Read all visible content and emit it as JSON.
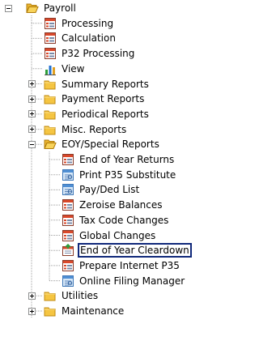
{
  "tree": {
    "root": {
      "label": "Payroll",
      "icon": "folder-open-icon",
      "expanded": true
    },
    "payroll_children": [
      {
        "label": "Processing",
        "icon": "report-icon"
      },
      {
        "label": "Calculation",
        "icon": "report-icon"
      },
      {
        "label": "P32 Processing",
        "icon": "report-icon"
      },
      {
        "label": "View",
        "icon": "bar-chart-icon"
      },
      {
        "label": "Summary Reports",
        "icon": "folder-icon",
        "expanded": false
      },
      {
        "label": "Payment Reports",
        "icon": "folder-icon",
        "expanded": false
      },
      {
        "label": "Periodical Reports",
        "icon": "folder-icon",
        "expanded": false
      },
      {
        "label": "Misc. Reports",
        "icon": "folder-icon",
        "expanded": false
      },
      {
        "label": "EOY/Special Reports",
        "icon": "folder-open-icon",
        "expanded": true
      }
    ],
    "eoy_children": [
      {
        "label": "End of Year Returns",
        "icon": "report-icon"
      },
      {
        "label": "Print P35 Substitute",
        "icon": "preview-icon"
      },
      {
        "label": "Pay/Ded List",
        "icon": "preview-icon"
      },
      {
        "label": "Zeroise Balances",
        "icon": "report-icon"
      },
      {
        "label": "Tax Code Changes",
        "icon": "report-icon"
      },
      {
        "label": "Global Changes",
        "icon": "report-icon"
      },
      {
        "label": "End of Year Cleardown",
        "icon": "cleardown-icon",
        "selected": true
      },
      {
        "label": "Prepare Internet P35",
        "icon": "report-icon"
      },
      {
        "label": "Online Filing Manager",
        "icon": "preview-icon"
      }
    ],
    "tail_children": [
      {
        "label": "Utilities",
        "icon": "folder-icon",
        "expanded": false
      },
      {
        "label": "Maintenance",
        "icon": "folder-icon",
        "expanded": false
      }
    ]
  },
  "colors": {
    "selection_border": "#10287a",
    "folder": "#f5c542",
    "report_red": "#d9482b",
    "tree_line": "#a0a0a0"
  }
}
